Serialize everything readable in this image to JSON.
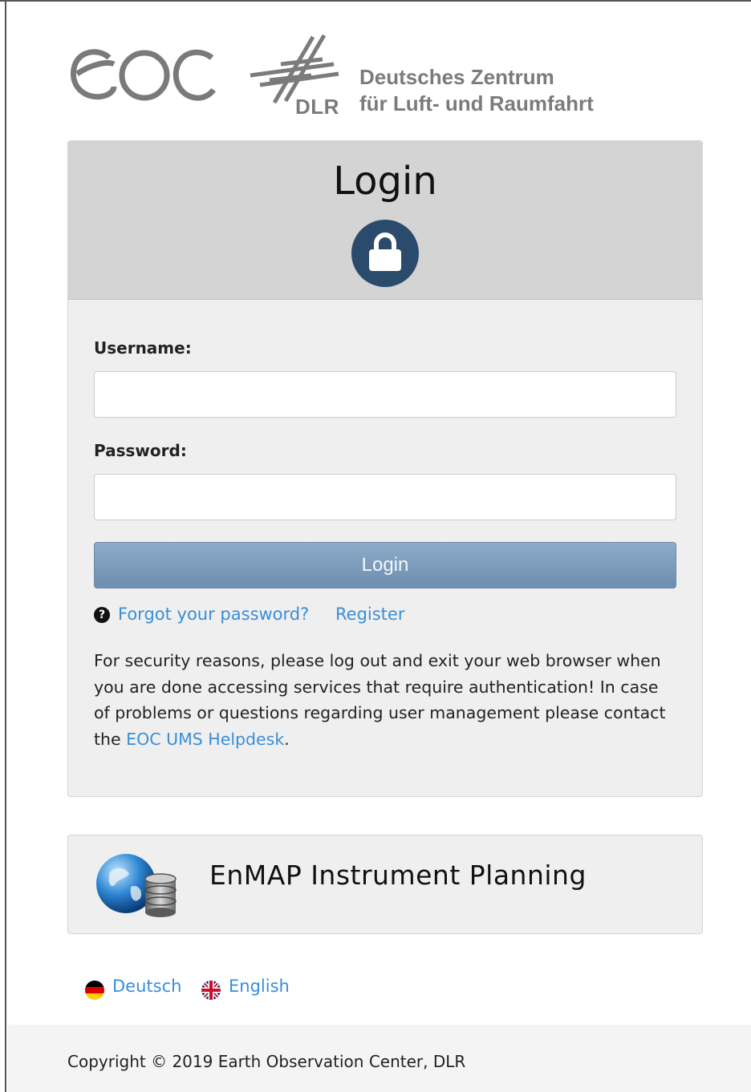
{
  "header": {
    "dlr_abbrev": "DLR",
    "dlr_name_line1": "Deutsches Zentrum",
    "dlr_name_line2": "für Luft- und Raumfahrt"
  },
  "login": {
    "title": "Login",
    "username_label": "Username:",
    "username_value": "",
    "password_label": "Password:",
    "password_value": "",
    "button_label": "Login",
    "forgot_label": "Forgot your password?",
    "register_label": "Register",
    "notice_text": "For security reasons, please log out and exit your web browser when you are done accessing services that require authentication! In case of problems or questions regarding user management please contact the ",
    "helpdesk_label": "EOC UMS Helpdesk",
    "notice_end": "."
  },
  "app": {
    "title": "EnMAP Instrument Planning"
  },
  "languages": [
    {
      "label": "Deutsch"
    },
    {
      "label": "English"
    }
  ],
  "footer": {
    "copyright": "Copyright © 2019 Earth Observation Center, DLR"
  },
  "colors": {
    "link": "#3a8ed6",
    "lock_circle": "#2b4b6d",
    "button": "#7f9ebf"
  },
  "icons": [
    "eoc-logo",
    "dlr-logo",
    "lock-icon",
    "question-circle-icon",
    "globe-database-icon",
    "german-flag-icon",
    "uk-flag-icon"
  ]
}
